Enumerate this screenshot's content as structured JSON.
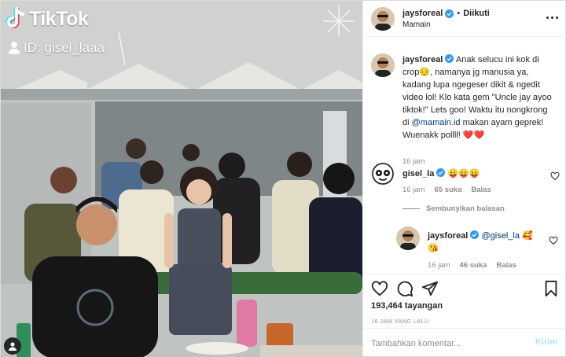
{
  "video": {
    "tiktok_logo_text": "TikTok",
    "tiktok_id": "ID: gisel_laaa",
    "icons": [
      "tiktok-note-icon",
      "person-icon",
      "user-tag-icon"
    ]
  },
  "header": {
    "username": "jaysforeal",
    "separator": "•",
    "follow_label": "Diikuti",
    "location": "Mamain"
  },
  "caption": {
    "username": "jaysforeal",
    "text_before_mention": "Anak selucu ini kok di crop😔, namanya jg manusia ya, kadang lupa ngegeser dikit & ngedit video lol! Klo kata gem \"Uncle jay ayoo tiktok!\" Lets goo! Waktu itu nongkrong di ",
    "mention": "@mamain.id",
    "text_after_mention": " makan ayam geprek! Wuenakk pollll! ❤️❤️",
    "time": "16 jam"
  },
  "comments": [
    {
      "username": "gisel_la",
      "text": "😛😛😛",
      "time": "16 jam",
      "likes": "65 suka",
      "reply_label": "Balas"
    }
  ],
  "hide_replies_label": "Sembunyikan balasan",
  "reply": {
    "username": "jaysforeal",
    "mention": "@gisel_la",
    "text": " 🥰😘",
    "time": "16 jam",
    "likes": "46 suka",
    "reply_label": "Balas"
  },
  "actions": {
    "icons": [
      "heart-icon",
      "comment-icon",
      "share-icon",
      "bookmark-icon"
    ],
    "views": "193,464 tayangan",
    "time_ago": "16 JAM YANG LALU"
  },
  "add_comment": {
    "placeholder": "Tambahkan komentar...",
    "post_label": "Kirim"
  },
  "colors": {
    "verified_blue": "#3897f0",
    "text": "#262626",
    "secondary": "#8e8e8e",
    "mention": "#00376b",
    "post_button_disabled": "#b2dffc",
    "heart_red": "#ed4956"
  }
}
